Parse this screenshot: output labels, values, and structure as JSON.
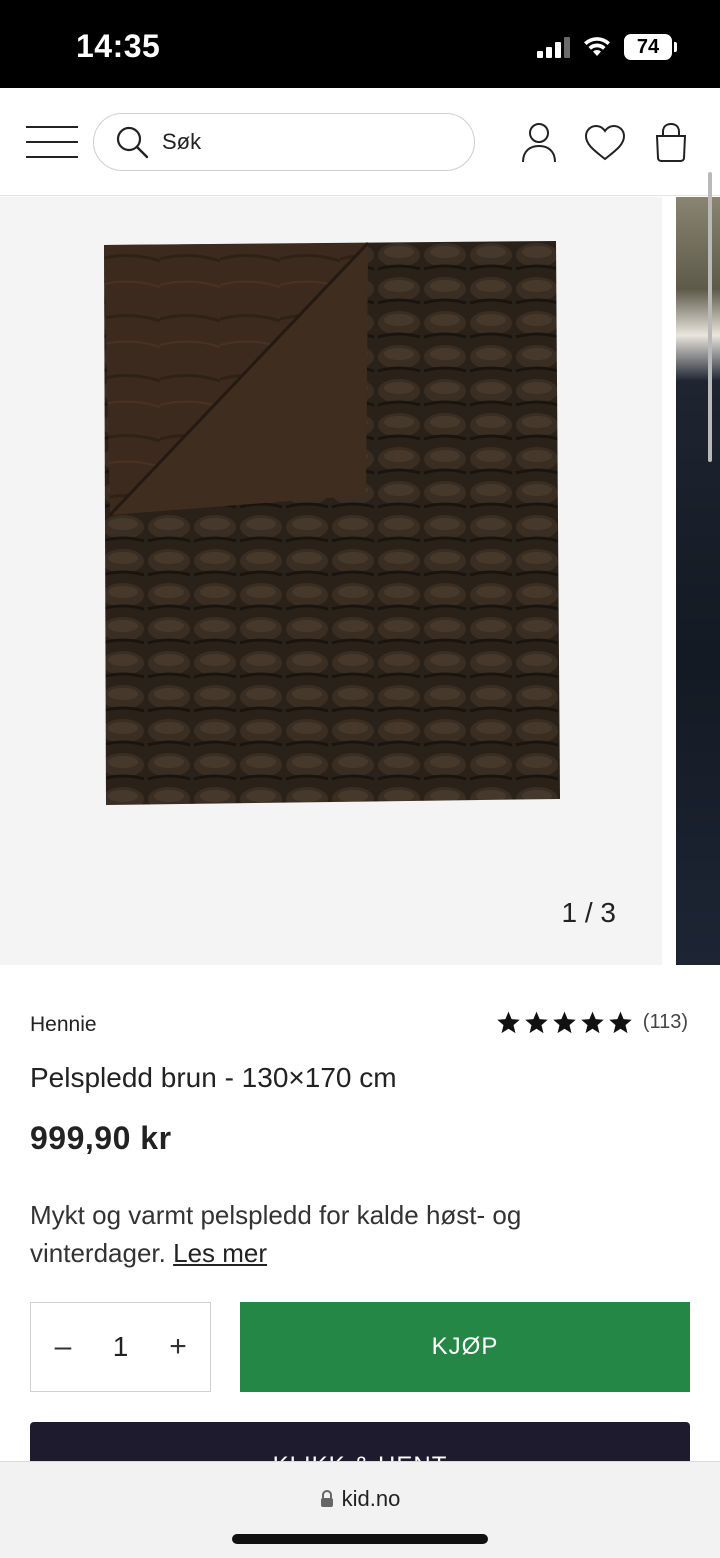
{
  "status_bar": {
    "time": "14:35",
    "battery": "74"
  },
  "header": {
    "search_placeholder": "Søk"
  },
  "gallery": {
    "counter": "1 / 3"
  },
  "product": {
    "brand": "Hennie",
    "rating_count": "(113)",
    "rating_stars": 5,
    "title": "Pelspledd brun - 130×170 cm",
    "price": "999,90 kr",
    "description": "Mykt og varmt pelspledd for kalde høst- og vinterdager.",
    "read_more": "Les mer"
  },
  "purchase": {
    "qty_minus": "–",
    "quantity": "1",
    "qty_plus": "+",
    "buy_label": "KJØP",
    "click_collect_label": "KLIKK & HENT"
  },
  "browser": {
    "url": "kid.no"
  },
  "colors": {
    "buy_button": "#258745",
    "click_button": "#1f1b2e"
  }
}
